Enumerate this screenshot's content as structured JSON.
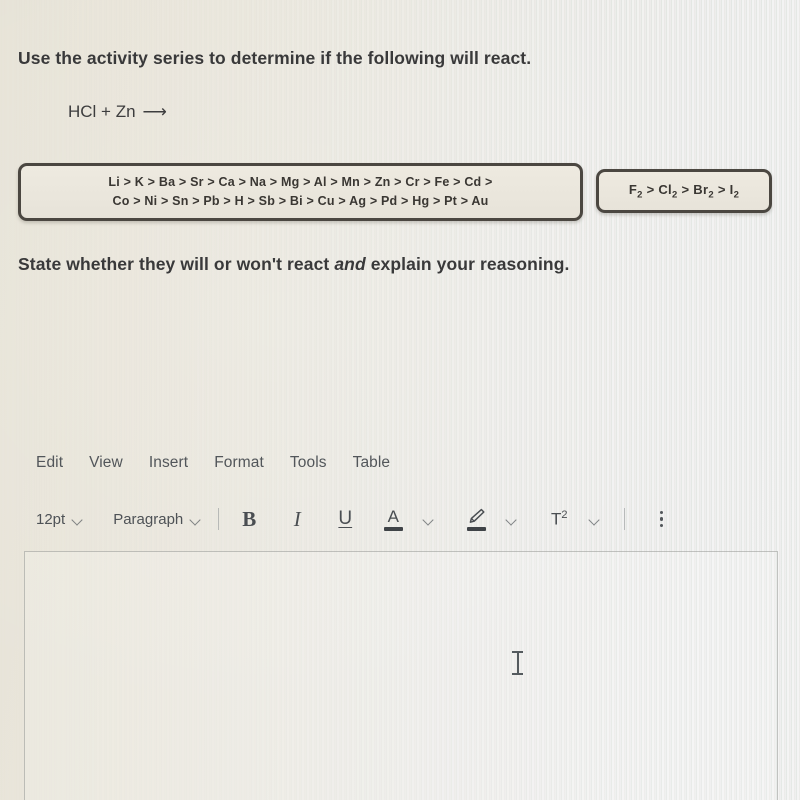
{
  "question": {
    "prompt": "Use the activity series to determine if the following will react.",
    "equation_reactants": "HCl + Zn",
    "equation_arrow": "⟶",
    "followup_before": "State whether they will or won't react ",
    "followup_italic": "and",
    "followup_after": " explain your reasoning."
  },
  "activity_series": {
    "metals": {
      "line1": "Li > K > Ba > Sr > Ca > Na > Mg > Al > Mn > Zn > Cr > Fe > Cd >",
      "line2": "Co > Ni > Sn > Pb > H > Sb > Bi > Cu > Ag > Pd > Hg > Pt > Au",
      "border_color": "#4b4741",
      "fill_color": "#eae6dc"
    },
    "halogens": {
      "line": "F2 > Cl2 > Br2 > I2",
      "border_color": "#4b4741",
      "fill_color": "#eae6dc"
    }
  },
  "editor": {
    "menubar": [
      {
        "label": "Edit"
      },
      {
        "label": "View"
      },
      {
        "label": "Insert"
      },
      {
        "label": "Format"
      },
      {
        "label": "Tools"
      },
      {
        "label": "Table"
      }
    ],
    "toolbar": {
      "font_size_value": "12pt",
      "block_format_value": "Paragraph",
      "bold_label": "B",
      "italic_label": "I",
      "underline_label": "U",
      "text_color_label": "A",
      "highlight_icon": "highlighter-pen-icon",
      "superscript_label": "T",
      "superscript_exponent": "2",
      "more_options_icon": "kebab-menu-icon"
    },
    "body_text": "",
    "cursor_icon": "text-ibeam-cursor"
  },
  "theme": {
    "text_color": "#39393a",
    "menu_text_color": "#52565a",
    "toolbar_icon_color": "#4a4e52",
    "page_background": "#eae7de"
  }
}
